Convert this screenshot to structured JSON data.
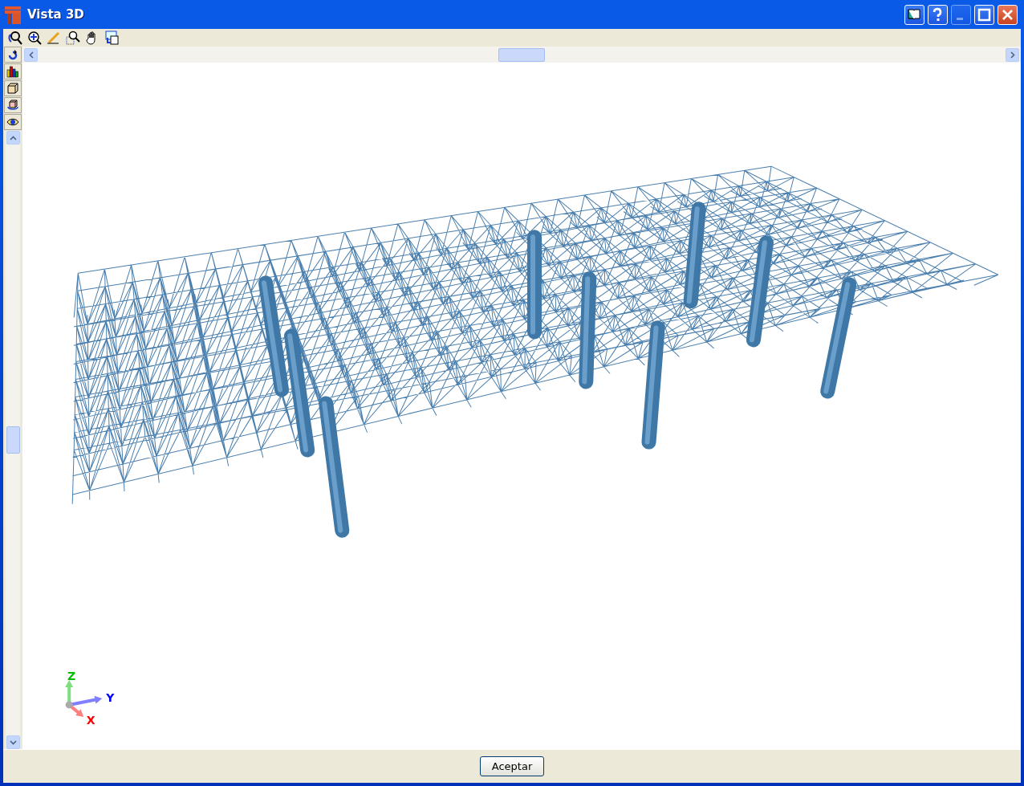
{
  "window": {
    "title": "Vista 3D"
  },
  "title_buttons": [
    {
      "kind": "book",
      "disabled": false
    },
    {
      "kind": "help",
      "disabled": false
    },
    {
      "kind": "minimize",
      "disabled": true
    },
    {
      "kind": "maximize",
      "disabled": false
    },
    {
      "kind": "close",
      "disabled": false
    }
  ],
  "axes": [
    {
      "label": "Z",
      "color": "#00c000"
    },
    {
      "label": "Y",
      "color": "#0000ff"
    },
    {
      "label": "X",
      "color": "#ff0000"
    }
  ],
  "buttons": [
    "Aceptar"
  ]
}
